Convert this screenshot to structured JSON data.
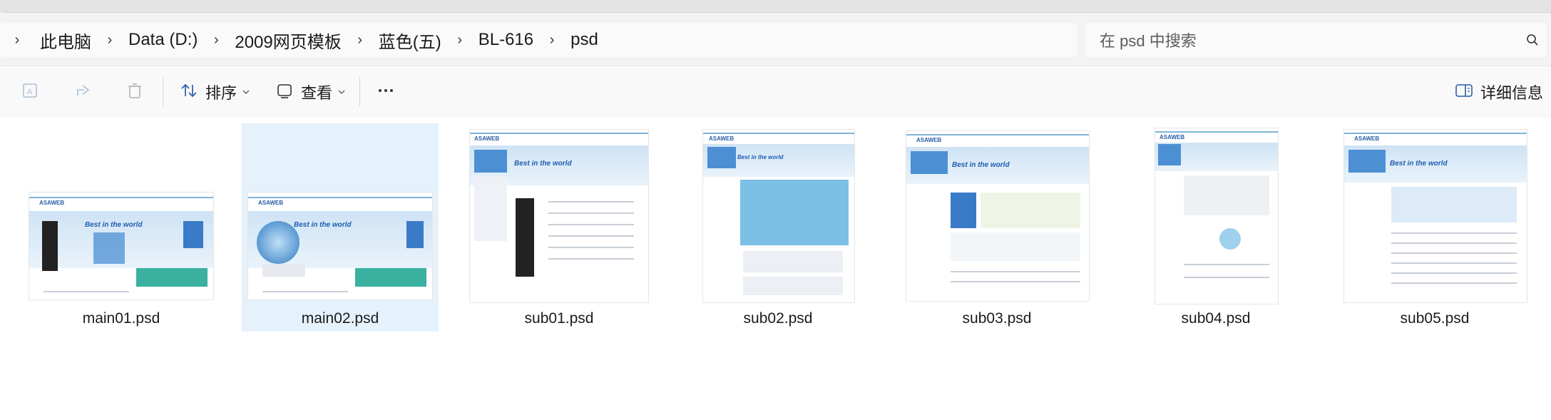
{
  "breadcrumb": {
    "items": [
      "此电脑",
      "Data (D:)",
      "2009网页模板",
      "蓝色(五)",
      "BL-616",
      "psd"
    ]
  },
  "search": {
    "placeholder": "在 psd 中搜索"
  },
  "toolbar": {
    "sort_label": "排序",
    "view_label": "查看",
    "details_label": "详细信息"
  },
  "files": [
    {
      "name": "main01.psd",
      "banner": "Best in the world",
      "selected": false
    },
    {
      "name": "main02.psd",
      "banner": "Best in the world",
      "selected": true
    },
    {
      "name": "sub01.psd",
      "banner": "Best in the world",
      "selected": false
    },
    {
      "name": "sub02.psd",
      "banner": "Best in the world",
      "selected": false
    },
    {
      "name": "sub03.psd",
      "banner": "Best in the world",
      "selected": false
    },
    {
      "name": "sub04.psd",
      "banner": "",
      "selected": false
    },
    {
      "name": "sub05.psd",
      "banner": "Best in the world",
      "selected": false
    }
  ],
  "colors": {
    "accent": "#0067c0",
    "selection": "#e5f1fb",
    "thumb_blue": "#4c8fd3"
  }
}
